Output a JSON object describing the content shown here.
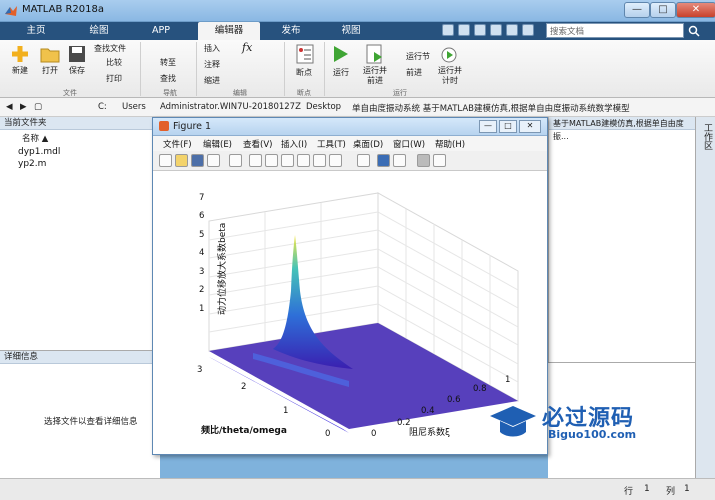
{
  "app": {
    "title": "MATLAB R2018a"
  },
  "window": {
    "minimize": "—",
    "maximize": "□",
    "close": "✕"
  },
  "tabs": [
    {
      "label": "主页"
    },
    {
      "label": "绘图"
    },
    {
      "label": "APP"
    },
    {
      "label": "编辑器"
    },
    {
      "label": "发布"
    },
    {
      "label": "视图"
    }
  ],
  "search": {
    "placeholder": "搜索文档"
  },
  "ribbon": {
    "file": {
      "new": "新建",
      "open": "打开",
      "save": "保存",
      "find_files": "查找文件",
      "compare": "比较",
      "print": "打印",
      "group": "文件"
    },
    "navigate": {
      "goto": "转至",
      "find": "查找",
      "group": "导航"
    },
    "edit": {
      "insert": "插入",
      "comment": "注释",
      "indent": "缩进",
      "fx": "fx",
      "group": "编辑"
    },
    "breakpoints": {
      "label": "断点",
      "group": "断点"
    },
    "run": {
      "run": "运行",
      "run_advance": "运行并\n前进",
      "run_section": "运行节",
      "advance": "前进",
      "run_time": "运行并\n计时",
      "group": "运行"
    }
  },
  "address": {
    "path": [
      "C:",
      "Users",
      "Administrator.WIN7U-20180127Z",
      "Desktop",
      "单自由度振动系统 基于MATLAB建模仿真,根据单自由度振动系统数学模型"
    ]
  },
  "current_folder": {
    "title": "当前文件夹",
    "column": "名称 ▲",
    "files": [
      "dyp1.mdl",
      "yp2.m"
    ]
  },
  "details": {
    "title": "详细信息",
    "message": "选择文件以查看详细信息"
  },
  "editor_tab": {
    "label": "基于MATLAB建模仿真,根据单自由度振..."
  },
  "side_label": "工作区",
  "figure": {
    "title": "Figure 1",
    "menu": [
      "文件(F)",
      "编辑(E)",
      "查看(V)",
      "插入(I)",
      "工具(T)",
      "桌面(D)",
      "窗口(W)",
      "帮助(H)"
    ],
    "zlabel": "动力位移放大系数beta",
    "xlabel": "阻尼系数ξ",
    "ylabel": "频比/theta/omega",
    "zticks": [
      "1",
      "2",
      "3",
      "4",
      "5",
      "6",
      "7"
    ],
    "xticks": [
      "0",
      "0.2",
      "0.4",
      "0.6",
      "0.8",
      "1"
    ],
    "yticks": [
      "0",
      "1",
      "2",
      "3"
    ]
  },
  "status": {
    "row_label": "行",
    "row": "1",
    "col_label": "列",
    "col": "1"
  },
  "watermark": {
    "text": "必过源码",
    "url": "Biguo100.com"
  },
  "colors": {
    "ribbon_tab_bg": "#27527e",
    "surface_low": "#3a1fb0",
    "surface_high": "#f5e642"
  }
}
